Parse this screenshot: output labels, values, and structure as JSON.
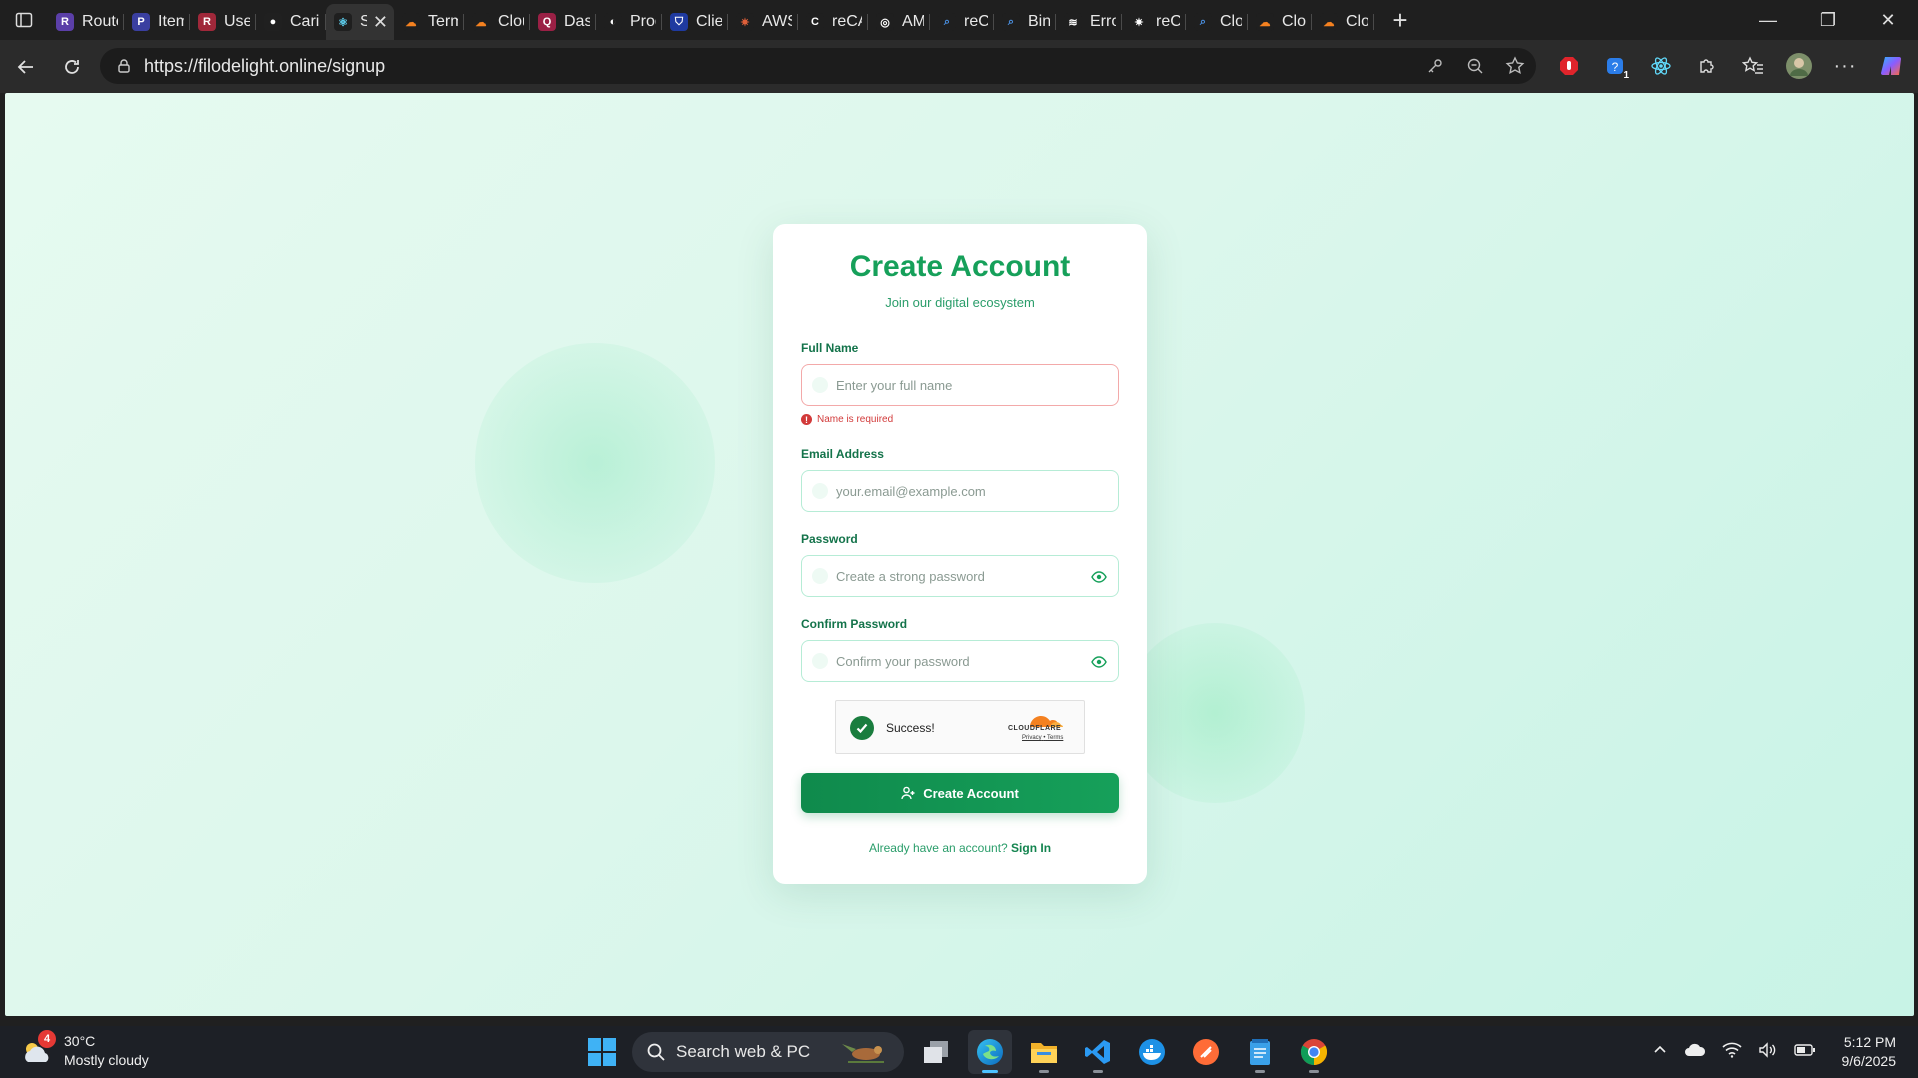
{
  "browser": {
    "tabs": [
      {
        "label": "Route",
        "fav_color": "#5b3fa8",
        "fav_glyph": "R",
        "icon": "app-icon"
      },
      {
        "label": "Items",
        "fav_color": "#3a3fa0",
        "fav_glyph": "P",
        "icon": "app-icon"
      },
      {
        "label": "Users",
        "fav_color": "#a0283a",
        "fav_glyph": "R",
        "icon": "app-icon"
      },
      {
        "label": "Carin",
        "fav_color": "#202020",
        "fav_glyph": "●",
        "icon": "github-icon"
      },
      {
        "label": "S",
        "fav_color": "#1f1f1f",
        "fav_glyph": "⚛",
        "icon": "react-icon",
        "active": true
      },
      {
        "label": "Terms",
        "fav_color": "#1f1f1f",
        "fav_glyph": "☁",
        "icon": "cloudflare-icon"
      },
      {
        "label": "Cloud",
        "fav_color": "#1f1f1f",
        "fav_glyph": "☁",
        "icon": "cloudflare-icon"
      },
      {
        "label": "Dasht",
        "fav_color": "#9a2045",
        "fav_glyph": "Q",
        "icon": "app-icon"
      },
      {
        "label": "Produ",
        "fav_color": "#1f1f1f",
        "fav_glyph": "◐",
        "icon": "app-icon"
      },
      {
        "label": "Client",
        "fav_color": "#1f3aa0",
        "fav_glyph": "⛉",
        "icon": "shield-icon"
      },
      {
        "label": "AWS",
        "fav_color": "#1f1f1f",
        "fav_glyph": "✷",
        "icon": "aws-icon"
      },
      {
        "label": "reCAI",
        "fav_color": "#1f1f1f",
        "fav_glyph": "C",
        "icon": "recaptcha-icon"
      },
      {
        "label": "AMP",
        "fav_color": "#1f1f1f",
        "fav_glyph": "◎",
        "icon": "app-icon"
      },
      {
        "label": "reCAI",
        "fav_color": "#1f1f1f",
        "fav_glyph": "⌕",
        "icon": "search-icon"
      },
      {
        "label": "Bing",
        "fav_color": "#1f1f1f",
        "fav_glyph": "⌕",
        "icon": "search-icon"
      },
      {
        "label": "Error:",
        "fav_color": "#1f1f1f",
        "fav_glyph": "≋",
        "icon": "stackoverflow-icon"
      },
      {
        "label": "reCAI",
        "fav_color": "#1f1f1f",
        "fav_glyph": "✷",
        "icon": "app-icon"
      },
      {
        "label": "Cloud",
        "fav_color": "#1f1f1f",
        "fav_glyph": "⌕",
        "icon": "search-icon"
      },
      {
        "label": "Cloud",
        "fav_color": "#1f1f1f",
        "fav_glyph": "☁",
        "icon": "cloudflare-icon"
      },
      {
        "label": "Cloud",
        "fav_color": "#1f1f1f",
        "fav_glyph": "☁",
        "icon": "cloudflare-icon"
      }
    ],
    "url": "https://filodelight.online/signup",
    "extension_badge": "1"
  },
  "signup": {
    "title": "Create Account",
    "subtitle": "Join our digital ecosystem",
    "full_name": {
      "label": "Full Name",
      "placeholder": "Enter your full name",
      "value": "",
      "error": "Name is required"
    },
    "email": {
      "label": "Email Address",
      "placeholder": "your.email@example.com",
      "value": ""
    },
    "password": {
      "label": "Password",
      "placeholder": "Create a strong password",
      "value": ""
    },
    "confirm_password": {
      "label": "Confirm Password",
      "placeholder": "Confirm your password",
      "value": ""
    },
    "captcha": {
      "status": "Success!",
      "brand": "CLOUDFLARE",
      "privacy": "Privacy",
      "sep": "•",
      "terms": "Terms"
    },
    "submit_label": "Create Account",
    "signin_prompt": "Already have an account?",
    "signin_link": "Sign In"
  },
  "taskbar": {
    "weather": {
      "badge": "4",
      "temp": "30°C",
      "condition": "Mostly cloudy"
    },
    "search_label": "Search web & PC",
    "clock": {
      "time": "5:12 PM",
      "date": "9/6/2025"
    }
  },
  "colors": {
    "accent": "#16a05a",
    "error": "#d23a3a",
    "tab_bg": "#1f1f1f",
    "toolbar_bg": "#2b2b2b"
  }
}
